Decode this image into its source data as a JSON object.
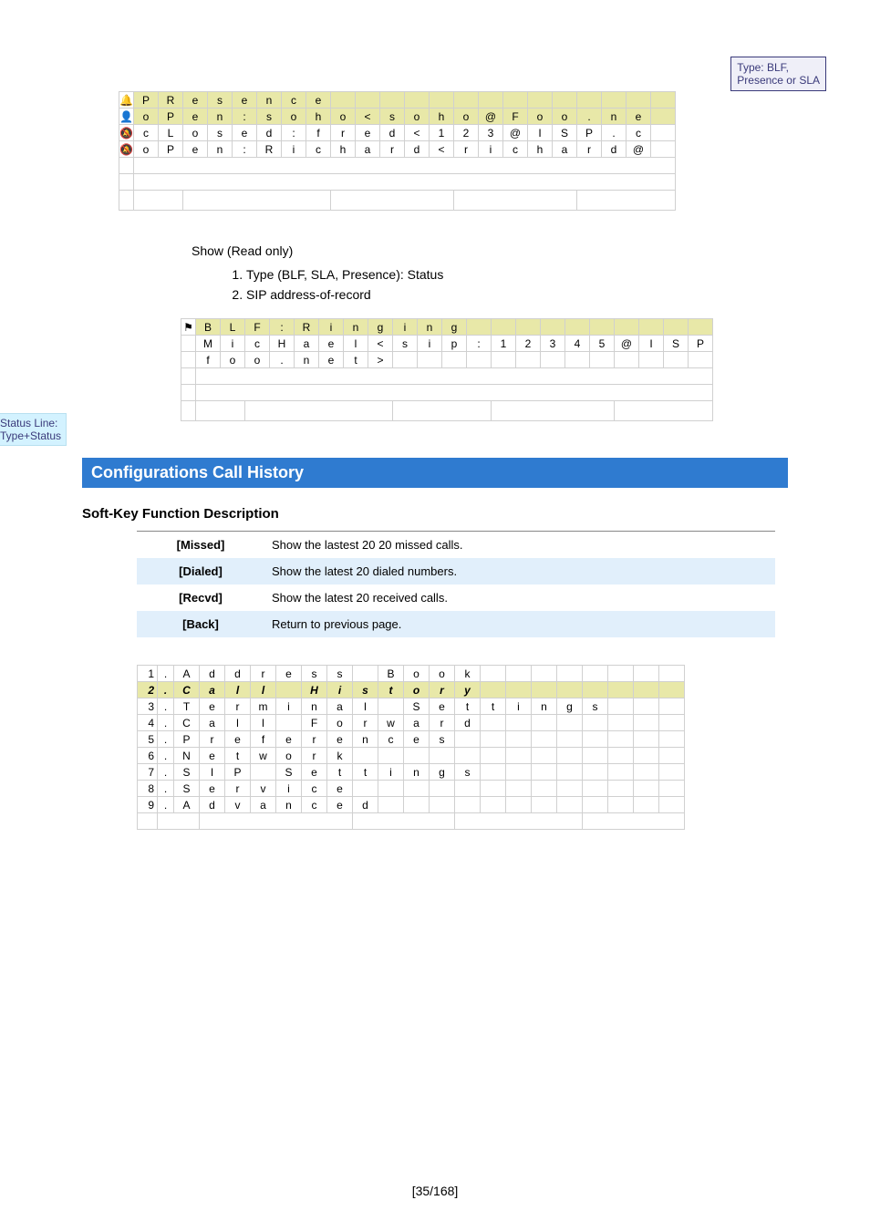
{
  "callouts": {
    "type_box": "Type: BLF,\nPresence or SLA",
    "status_box": "Status Line:\nType+Status"
  },
  "table1": {
    "r0": [
      "P",
      "R",
      "e",
      "s",
      "e",
      "n",
      "c",
      "e",
      "",
      "",
      "",
      "",
      "",
      "",
      "",
      "",
      "",
      "",
      "",
      "",
      "",
      ""
    ],
    "r1": [
      "o",
      "P",
      "e",
      "n",
      ":",
      "s",
      "o",
      "h",
      "o",
      "<",
      "s",
      "o",
      "h",
      "o",
      "@",
      "F",
      "o",
      "o",
      ".",
      "n",
      "e"
    ],
    "r2": [
      "c",
      "L",
      "o",
      "s",
      "e",
      "d",
      ":",
      "f",
      "r",
      "e",
      "d",
      "<",
      "1",
      "2",
      "3",
      "@",
      "I",
      "S",
      "P",
      ".",
      "c"
    ],
    "r3": [
      "o",
      "P",
      "e",
      "n",
      ":",
      "R",
      "i",
      "c",
      "h",
      "a",
      "r",
      "d",
      "<",
      "r",
      "i",
      "c",
      "h",
      "a",
      "r",
      "d",
      "@"
    ]
  },
  "show_label": "Show (Read only)",
  "ol": {
    "i1": "Type (BLF, SLA, Presence): Status",
    "i2": "SIP address-of-record"
  },
  "table2": {
    "h": [
      "B",
      "L",
      "F",
      ":",
      "R",
      "i",
      "n",
      "g",
      "i",
      "n",
      "g",
      "",
      "",
      "",
      "",
      "",
      "",
      "",
      "",
      "",
      ""
    ],
    "r1": [
      "M",
      "i",
      "c",
      "H",
      "a",
      "e",
      "l",
      "<",
      "s",
      "i",
      "p",
      ":",
      "1",
      "2",
      "3",
      "4",
      "5",
      "@",
      "I",
      "S",
      "P",
      "."
    ],
    "r2": [
      "f",
      "o",
      "o",
      ".",
      "n",
      "e",
      "t",
      ">",
      "",
      "",
      "",
      "",
      "",
      "",
      "",
      "",
      "",
      "",
      "",
      "",
      "",
      ""
    ]
  },
  "config_bar": "Configurations Call History",
  "sk_title": "Soft-Key Function Description",
  "softkeys": [
    {
      "label": "[Missed]",
      "desc": "Show the lastest 20 20 missed calls."
    },
    {
      "label": "[Dialed]",
      "desc": "Show the latest 20 dialed numbers."
    },
    {
      "label": "[Recvd]",
      "desc": "Show the latest 20 received calls."
    },
    {
      "label": "[Back]",
      "desc": "Return to previous page."
    }
  ],
  "table3": {
    "rows": [
      [
        "1",
        ".",
        "A",
        "d",
        "d",
        "r",
        "e",
        "s",
        "s",
        "",
        "B",
        "o",
        "o",
        "k",
        "",
        "",
        "",
        "",
        "",
        "",
        "",
        ""
      ],
      [
        "2",
        ".",
        "C",
        "a",
        "l",
        "l",
        "",
        "H",
        "i",
        "s",
        "t",
        "o",
        "r",
        "y",
        "",
        "",
        "",
        "",
        "",
        "",
        "",
        ""
      ],
      [
        "3",
        ".",
        "T",
        "e",
        "r",
        "m",
        "i",
        "n",
        "a",
        "l",
        "",
        "S",
        "e",
        "t",
        "t",
        "i",
        "n",
        "g",
        "s",
        "",
        "",
        ""
      ],
      [
        "4",
        ".",
        "C",
        "a",
        "l",
        "l",
        "",
        "F",
        "o",
        "r",
        "w",
        "a",
        "r",
        "d",
        "",
        "",
        "",
        "",
        "",
        "",
        "",
        ""
      ],
      [
        "5",
        ".",
        "P",
        "r",
        "e",
        "f",
        "e",
        "r",
        "e",
        "n",
        "c",
        "e",
        "s",
        "",
        "",
        "",
        "",
        "",
        "",
        "",
        "",
        ""
      ],
      [
        "6",
        ".",
        "N",
        "e",
        "t",
        "w",
        "o",
        "r",
        "k",
        "",
        "",
        "",
        "",
        "",
        "",
        "",
        "",
        "",
        "",
        "",
        "",
        ""
      ],
      [
        "7",
        ".",
        "S",
        "I",
        "P",
        "",
        "S",
        "e",
        "t",
        "t",
        "i",
        "n",
        "g",
        "s",
        "",
        "",
        "",
        "",
        "",
        "",
        "",
        ""
      ],
      [
        "8",
        ".",
        "S",
        "e",
        "r",
        "v",
        "i",
        "c",
        "e",
        "",
        "",
        "",
        "",
        "",
        "",
        "",
        "",
        "",
        "",
        "",
        "",
        ""
      ],
      [
        "9",
        ".",
        "A",
        "d",
        "v",
        "a",
        "n",
        "c",
        "e",
        "d",
        "",
        "",
        "",
        "",
        "",
        "",
        "",
        "",
        "",
        "",
        "",
        ""
      ]
    ]
  },
  "footer": "[35/168]"
}
